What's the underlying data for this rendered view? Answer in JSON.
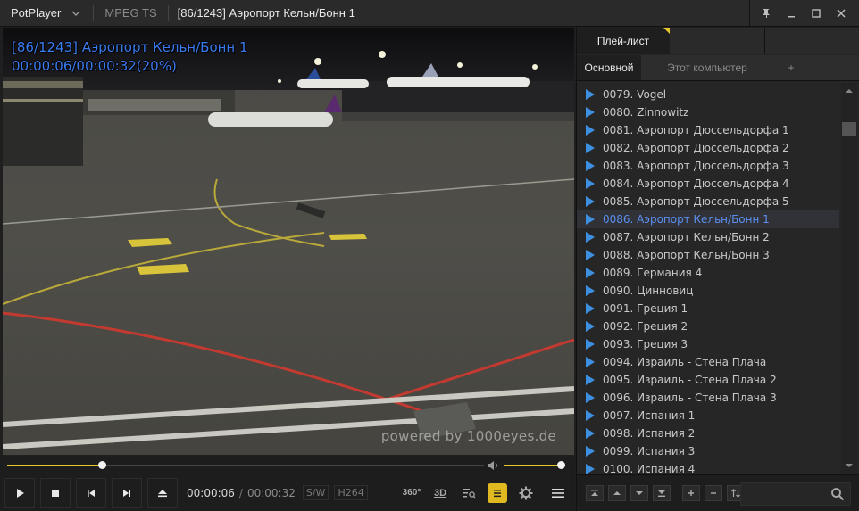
{
  "window": {
    "app_name": "PotPlayer",
    "format": "MPEG TS",
    "title": "[86/1243] Аэропорт Кельн/Бонн 1"
  },
  "video": {
    "osd_title": "[86/1243] Аэропорт Кельн/Бонн 1",
    "osd_time": "00:00:06/00:00:32(20%)",
    "watermark": "powered by 1000eyes.de"
  },
  "playback": {
    "current_time": "00:00:06",
    "duration": "00:00:32",
    "progress_fraction": 0.2,
    "volume_fraction": 1.0,
    "decoder_tag": "S/W",
    "codec_tag": "H264",
    "tool_360": "360°",
    "tool_3d": "3D"
  },
  "playlist": {
    "panel_tab": "Плей-лист",
    "subtabs": [
      "Основной",
      "Этот компьютер",
      "+"
    ],
    "current_index": 7,
    "items": [
      "0079. Vogel",
      "0080. Zinnowitz",
      "0081. Аэропорт Дюссельдорфа 1",
      "0082. Аэропорт Дюссельдорфа 2",
      "0083. Аэропорт Дюссельдорфа 3",
      "0084. Аэропорт Дюссельдорфа 4",
      "0085. Аэропорт Дюссельдорфа 5",
      "0086. Аэропорт Кельн/Бонн 1",
      "0087. Аэропорт Кельн/Бонн 2",
      "0088. Аэропорт Кельн/Бонн 3",
      "0089. Германия 4",
      "0090. Цинновиц",
      "0091. Греция 1",
      "0092. Греция 2",
      "0093. Греция 3",
      "0094. Израиль - Стена Плача",
      "0095. Израиль - Стена Плача 2",
      "0096. Израиль - Стена Плача 3",
      "0097. Испания 1",
      "0098. Испания 2",
      "0099. Испания 3",
      "0100. Испания 4"
    ],
    "search_value": ""
  },
  "colors": {
    "accent": "#e8c72a",
    "osd_text": "#3b7bf0",
    "current_item": "#5b8ff0"
  }
}
